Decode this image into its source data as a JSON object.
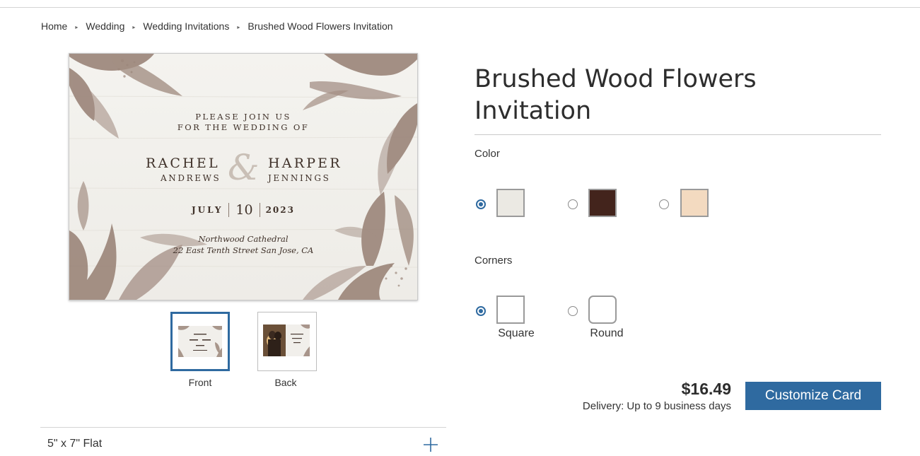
{
  "breadcrumb": {
    "items": [
      "Home",
      "Wedding",
      "Wedding Invitations",
      "Brushed Wood Flowers Invitation"
    ],
    "separator": "▸"
  },
  "product": {
    "title": "Brushed Wood Flowers Invitation",
    "price": "$16.49",
    "delivery": "Delivery: Up to 9 business days",
    "customize_label": "Customize Card",
    "size_label": "5\" x 7\" Flat"
  },
  "card": {
    "invite_line1": "PLEASE JOIN US",
    "invite_line2": "FOR THE WEDDING OF",
    "name1_first": "RACHEL",
    "name1_last": "ANDREWS",
    "ampersand": "&",
    "name2_first": "HARPER",
    "name2_last": "JENNINGS",
    "month": "JULY",
    "day": "10",
    "year": "2023",
    "venue_line1": "Northwood Cathedral",
    "venue_line2": "22 East Tenth Street San Jose, CA"
  },
  "thumbnails": [
    {
      "label": "Front",
      "selected": true
    },
    {
      "label": "Back",
      "selected": false
    }
  ],
  "color": {
    "label": "Color",
    "options": [
      {
        "color": "#ebe9e3",
        "selected": true
      },
      {
        "color": "#43241c",
        "selected": false
      },
      {
        "color": "#f3dac0",
        "selected": false
      }
    ]
  },
  "corners": {
    "label": "Corners",
    "options": [
      {
        "label": "Square",
        "selected": true
      },
      {
        "label": "Round",
        "selected": false
      }
    ]
  },
  "colors": {
    "accent": "#2f6aa0",
    "flower": "#9a8378",
    "card_bg": "#f2f1ee"
  },
  "icons": {
    "expand": "plus-icon",
    "crumb_separator": "triangle-right-icon"
  }
}
